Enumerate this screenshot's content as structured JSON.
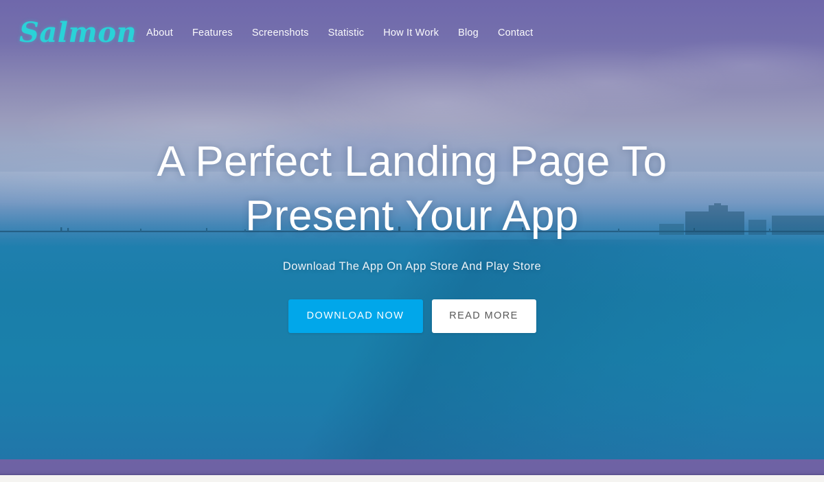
{
  "brand": {
    "name": "Salmon",
    "color": "#2ad2d8"
  },
  "nav": {
    "items": [
      {
        "label": "About"
      },
      {
        "label": "Features"
      },
      {
        "label": "Screenshots"
      },
      {
        "label": "Statistic"
      },
      {
        "label": "How It Work"
      },
      {
        "label": "Blog"
      },
      {
        "label": "Contact"
      }
    ]
  },
  "hero": {
    "title": "A Perfect Landing Page To Present Your App",
    "subtitle": "Download The App On App Store And Play Store",
    "primary_button": "DOWNLOAD NOW",
    "secondary_button": "READ MORE",
    "primary_button_color": "#01a7ea",
    "secondary_button_color": "#ffffff",
    "secondary_button_text_color": "#585858",
    "title_color": "#ffffff",
    "background_top_color": "#6f68ab",
    "background_bottom_color": "#1d7cab"
  },
  "footer_bar": {
    "color": "#6e62a4"
  }
}
